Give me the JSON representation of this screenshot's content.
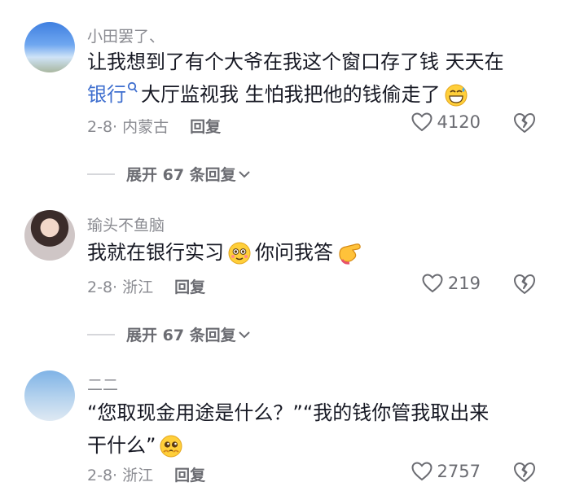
{
  "comments": [
    {
      "username": "小田罢了、",
      "text_before": "让我想到了有个大爷在我这个窗口存了钱 天天在",
      "link": "银行",
      "text_after": "大厅监视我 生怕我把他的钱偷走了",
      "date_location": "2-8· 内蒙古",
      "reply": "回复",
      "likes": "4120",
      "expand": "展开 67 条回复"
    },
    {
      "username": "瑜头不鱼脑",
      "text_before": "我就在银行实习",
      "text_after": "你问我答",
      "date_location": "2-8· 浙江",
      "reply": "回复",
      "likes": "219",
      "expand": "展开 67 条回复"
    },
    {
      "username": "二二",
      "line1": "“您取现金用途是什么？”“我的钱你管我取出来",
      "line2": "干什么”",
      "date_location": "2-8· 浙江",
      "reply": "回复",
      "likes": "2757"
    }
  ],
  "icons": {
    "like": "heart-outline-icon",
    "dislike": "broken-heart-icon",
    "expand": "chevron-down-icon",
    "search": "search-icon"
  },
  "colors": {
    "link": "#3f6fcf",
    "meta": "#8a8b91",
    "text": "#161823"
  }
}
